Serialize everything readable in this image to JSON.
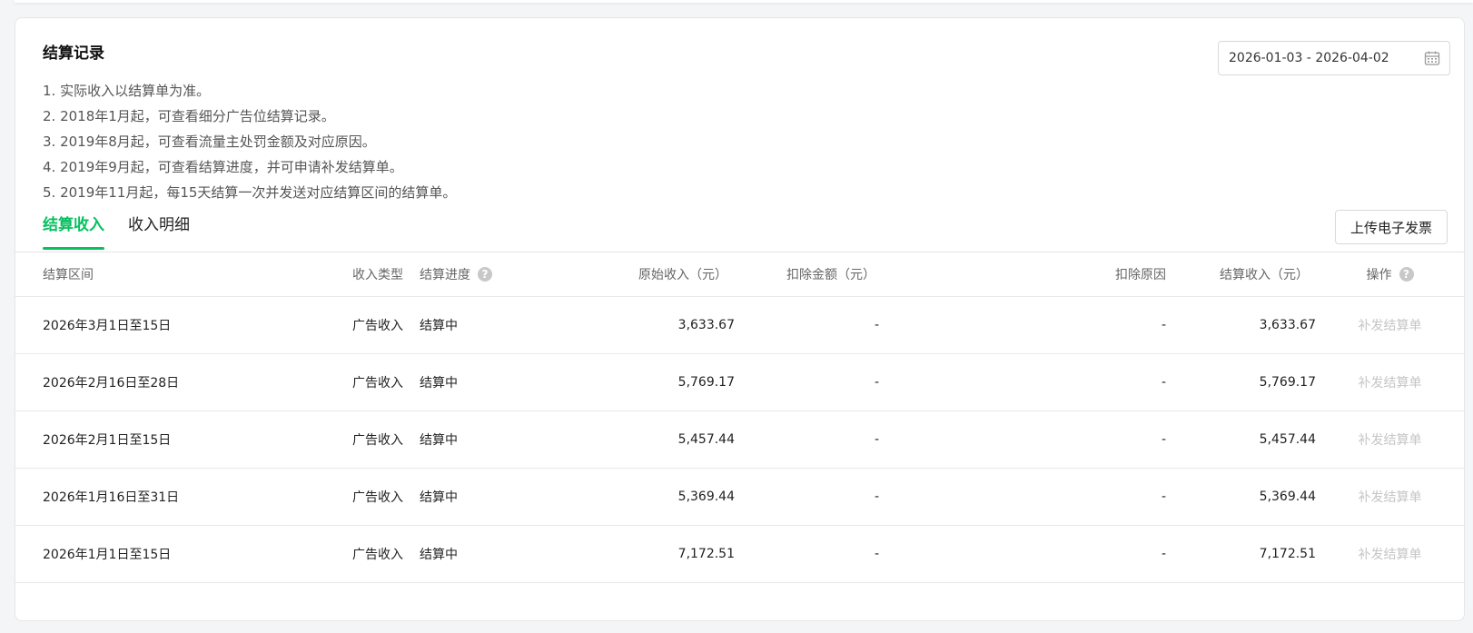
{
  "title": "结算记录",
  "notes": [
    "1. 实际收入以结算单为准。",
    "2. 2018年1月起，可查看细分广告位结算记录。",
    "3. 2019年8月起，可查看流量主处罚金额及对应原因。",
    "4. 2019年9月起，可查看结算进度，并可申请补发结算单。",
    "5. 2019年11月起，每15天结算一次并发送对应结算区间的结算单。"
  ],
  "date_range": {
    "value": "2026-01-03 - 2026-04-02",
    "icon": "calendar-icon"
  },
  "tabs": [
    {
      "label": "结算收入",
      "active": true
    },
    {
      "label": "收入明细",
      "active": false
    }
  ],
  "upload_button_label": "上传电子发票",
  "accent_color": "#07c160",
  "table": {
    "headers": {
      "period": "结算区间",
      "type": "收入类型",
      "progress": "结算进度",
      "original": "原始收入（元）",
      "deduct_amount": "扣除金额（元）",
      "deduct_reason": "扣除原因",
      "settled": "结算收入（元）",
      "action": "操作",
      "help_icon": "question-circle-icon"
    },
    "rows": [
      {
        "period": "2026年3月1日至15日",
        "type": "广告收入",
        "progress": "结算中",
        "original": "3,633.67",
        "deduct_amount": "-",
        "deduct_reason": "-",
        "settled": "3,633.67",
        "action": "补发结算单"
      },
      {
        "period": "2026年2月16日至28日",
        "type": "广告收入",
        "progress": "结算中",
        "original": "5,769.17",
        "deduct_amount": "-",
        "deduct_reason": "-",
        "settled": "5,769.17",
        "action": "补发结算单"
      },
      {
        "period": "2026年2月1日至15日",
        "type": "广告收入",
        "progress": "结算中",
        "original": "5,457.44",
        "deduct_amount": "-",
        "deduct_reason": "-",
        "settled": "5,457.44",
        "action": "补发结算单"
      },
      {
        "period": "2026年1月16日至31日",
        "type": "广告收入",
        "progress": "结算中",
        "original": "5,369.44",
        "deduct_amount": "-",
        "deduct_reason": "-",
        "settled": "5,369.44",
        "action": "补发结算单"
      },
      {
        "period": "2026年1月1日至15日",
        "type": "广告收入",
        "progress": "结算中",
        "original": "7,172.51",
        "deduct_amount": "-",
        "deduct_reason": "-",
        "settled": "7,172.51",
        "action": "补发结算单"
      }
    ]
  }
}
